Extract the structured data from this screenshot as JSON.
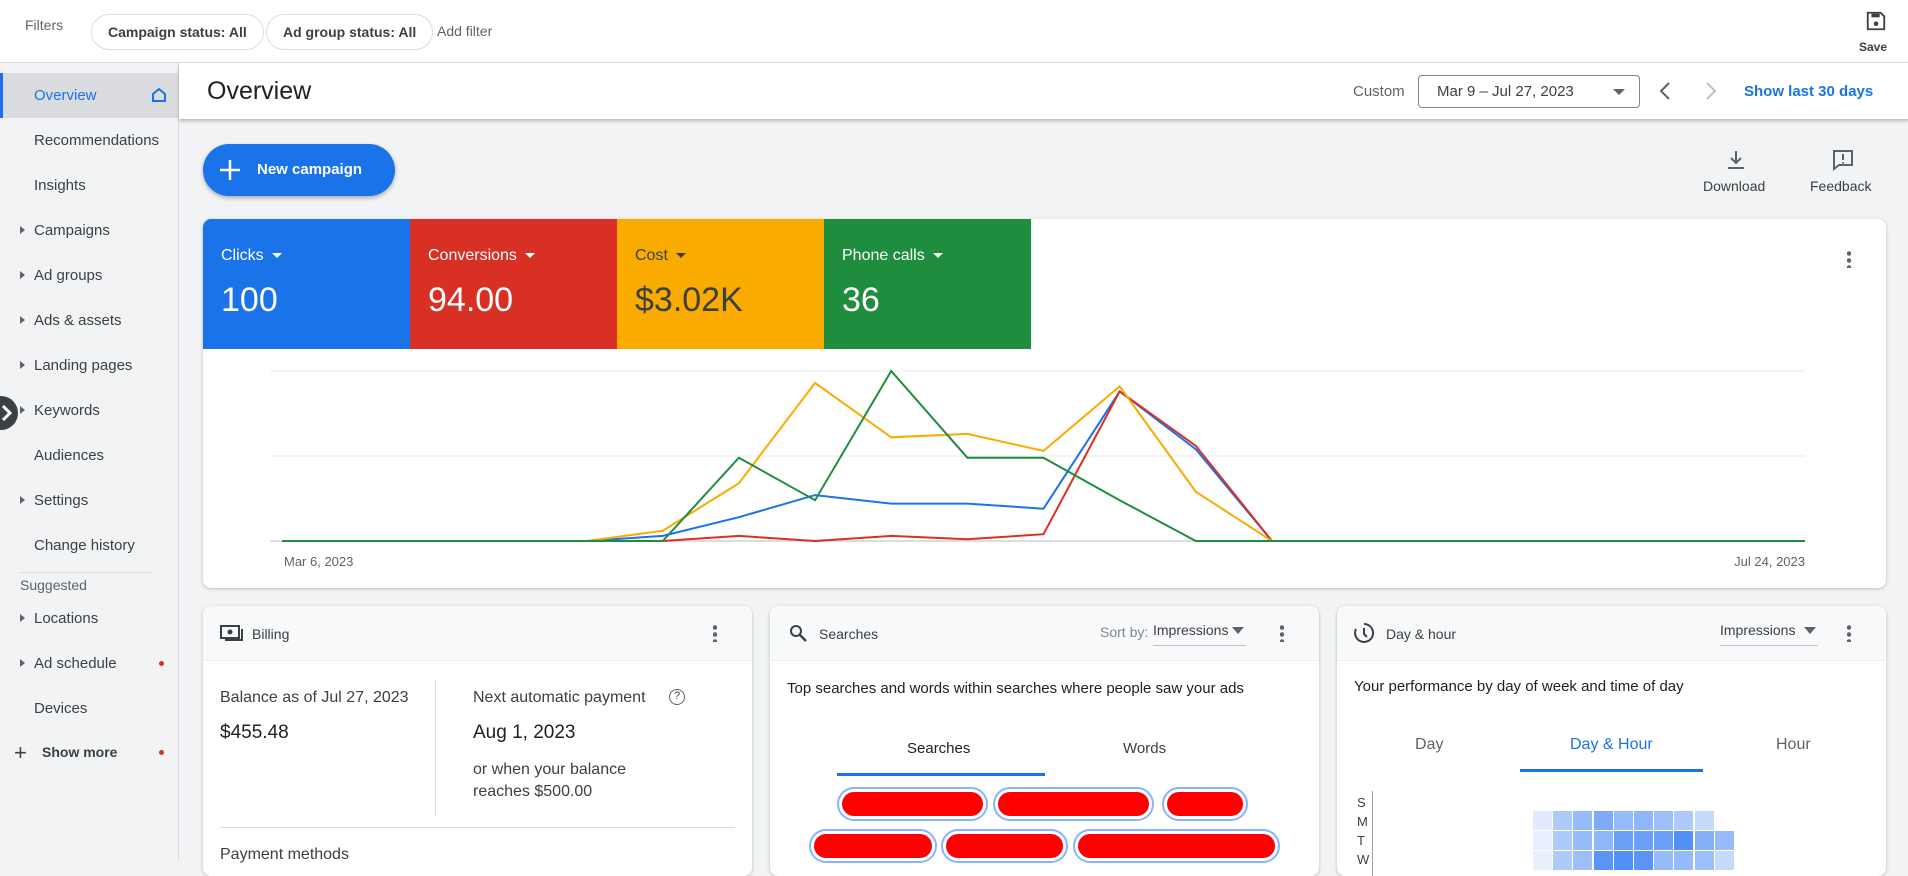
{
  "filters": {
    "label": "Filters",
    "chips": [
      "Campaign status: All",
      "Ad group status: All"
    ],
    "add": "Add filter",
    "save": "Save"
  },
  "sidebar": {
    "items": [
      {
        "label": "Overview",
        "active": true,
        "icon": "home-icon"
      },
      {
        "label": "Recommendations"
      },
      {
        "label": "Insights"
      },
      {
        "label": "Campaigns",
        "expand": true
      },
      {
        "label": "Ad groups",
        "expand": true
      },
      {
        "label": "Ads & assets",
        "expand": true
      },
      {
        "label": "Landing pages",
        "expand": true
      },
      {
        "label": "Keywords",
        "expand": true
      },
      {
        "label": "Audiences"
      },
      {
        "label": "Settings",
        "expand": true
      },
      {
        "label": "Change history"
      }
    ],
    "suggested_label": "Suggested",
    "suggested": [
      {
        "label": "Locations",
        "expand": true
      },
      {
        "label": "Ad schedule",
        "expand": true,
        "dot": true
      },
      {
        "label": "Devices"
      }
    ],
    "show_more": "Show more"
  },
  "header": {
    "title": "Overview",
    "custom": "Custom",
    "date_range": "Mar 9 – Jul 27, 2023",
    "show_last": "Show last 30 days"
  },
  "actions": {
    "new_campaign": "New campaign",
    "download": "Download",
    "feedback": "Feedback"
  },
  "metrics": [
    {
      "label": "Clicks",
      "value": "100",
      "color": "#1a73e8"
    },
    {
      "label": "Conversions",
      "value": "94.00",
      "color": "#d93025"
    },
    {
      "label": "Cost",
      "value": "$3.02K",
      "color": "#f9ab00"
    },
    {
      "label": "Phone calls",
      "value": "36",
      "color": "#1e8e3e"
    }
  ],
  "chart_data": {
    "type": "line",
    "x_start_label": "Mar 6, 2023",
    "x_end_label": "Jul 24, 2023",
    "x": [
      "Mar 6",
      "Mar 13",
      "Mar 20",
      "Mar 27",
      "Apr 3",
      "Apr 10",
      "Apr 17",
      "Apr 24",
      "May 1",
      "May 8",
      "May 15",
      "May 22",
      "May 29",
      "Jun 5",
      "Jun 12",
      "Jun 19",
      "Jun 26",
      "Jul 3",
      "Jul 10",
      "Jul 17",
      "Jul 24"
    ],
    "grid": true,
    "y_scale": "relative (0-100, no tick labels shown)",
    "series": [
      {
        "metric": "Clicks",
        "color": "#1a73e8",
        "values": [
          0,
          0,
          0,
          0,
          0,
          3,
          14,
          27,
          22,
          22,
          19,
          88,
          54,
          0,
          0,
          0,
          0,
          0,
          0,
          0,
          0
        ]
      },
      {
        "metric": "Conversions",
        "color": "#d93025",
        "values": [
          0,
          0,
          0,
          0,
          0,
          0,
          3,
          0,
          3,
          1,
          4,
          88,
          56,
          0,
          0,
          0,
          0,
          0,
          0,
          0,
          0
        ]
      },
      {
        "metric": "Cost",
        "color": "#f9ab00",
        "values": [
          0,
          0,
          0,
          0,
          0,
          6,
          34,
          93,
          61,
          63,
          53,
          91,
          29,
          0,
          0,
          0,
          0,
          0,
          0,
          0,
          0
        ]
      },
      {
        "metric": "Phone calls",
        "color": "#1e8e3e",
        "values": [
          0,
          0,
          0,
          0,
          0,
          0,
          49,
          24,
          100,
          49,
          49,
          24,
          0,
          0,
          0,
          0,
          0,
          0,
          0,
          0,
          0
        ]
      }
    ]
  },
  "billing": {
    "title": "Billing",
    "balance_label": "Balance as of Jul 27, 2023",
    "balance": "$455.48",
    "next_label": "Next automatic payment",
    "next_date": "Aug 1, 2023",
    "next_note": "or when your balance reaches $500.00",
    "payment_methods": "Payment methods"
  },
  "searches": {
    "title": "Searches",
    "sort_label": "Sort by:",
    "sort_value": "Impressions",
    "description": "Top searches and words within searches where people saw your ads",
    "tabs": [
      "Searches",
      "Words"
    ]
  },
  "dayhour": {
    "title": "Day & hour",
    "metric": "Impressions",
    "description": "Your performance by day of week and time of day",
    "tabs": [
      "Day",
      "Day & Hour",
      "Hour"
    ],
    "days": [
      "S",
      "M",
      "T",
      "W"
    ],
    "heat": [
      [
        0.05,
        0.35,
        0.5,
        0.65,
        0.5,
        0.55,
        0.45,
        0.35,
        0.2
      ],
      [
        0,
        0.35,
        0.5,
        0.55,
        0.75,
        0.75,
        0.75,
        0.9,
        0.6,
        0.5
      ],
      [
        0,
        0.35,
        0.45,
        0.85,
        0.9,
        0.85,
        0.5,
        0.5,
        0.45,
        0.2
      ]
    ]
  }
}
